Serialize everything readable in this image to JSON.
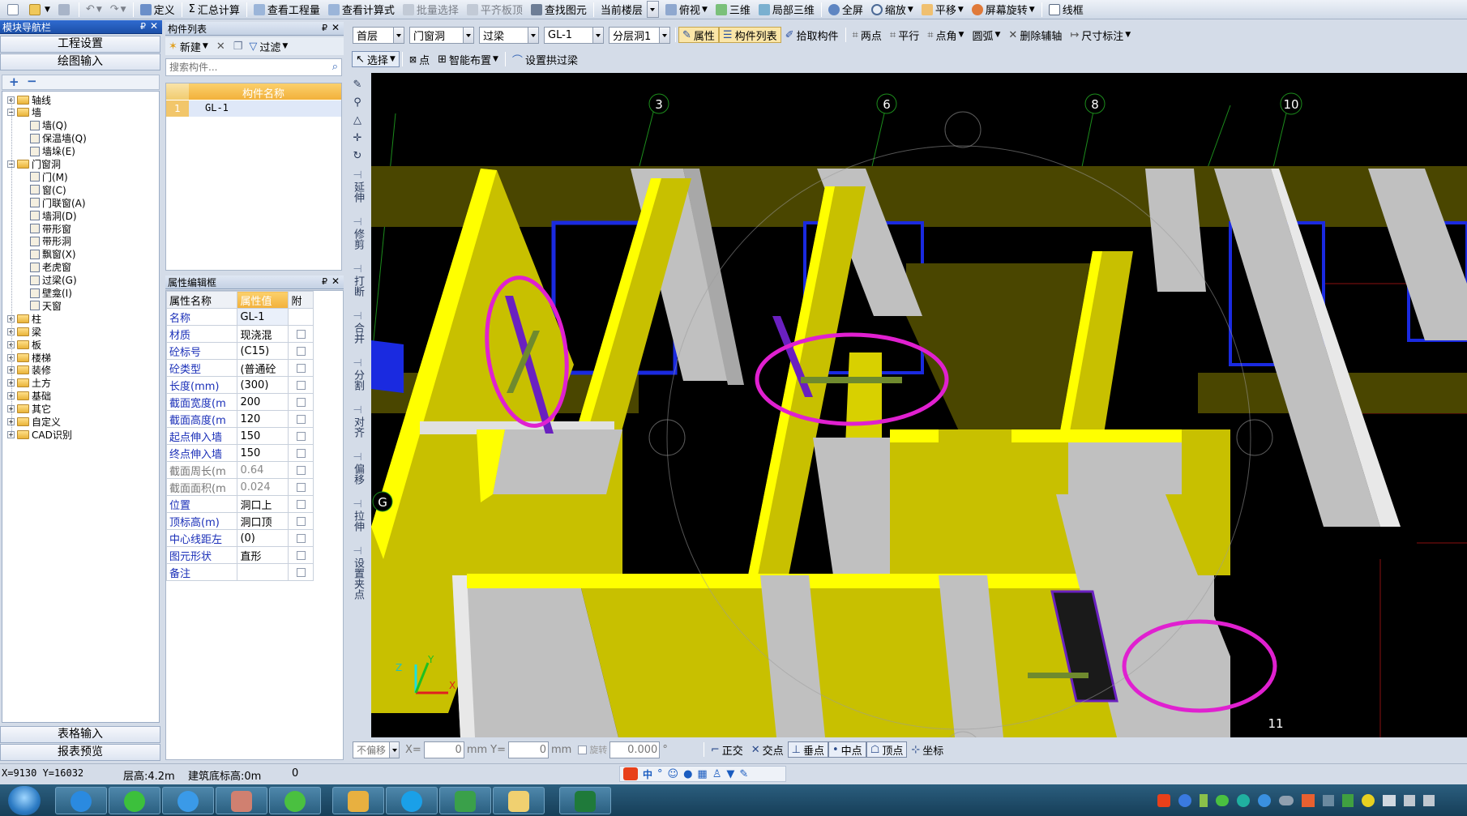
{
  "menu_toolbar": {
    "items": [
      "定义",
      "汇总计算",
      "查看工程量",
      "查看计算式",
      "批量选择",
      "平齐板顶",
      "查找图元",
      "当前楼层",
      "俯视",
      "三维",
      "局部三维",
      "全屏",
      "缩放",
      "平移",
      "屏幕旋转",
      "线框"
    ],
    "disabled": [
      "批量选择",
      "平齐板顶"
    ]
  },
  "nav": {
    "title": "模块导航栏",
    "project_settings": "工程设置",
    "drawing_input": "绘图输入",
    "plus": "+",
    "minus": "−",
    "tree": [
      {
        "label": "轴线",
        "level": 0
      },
      {
        "label": "墙",
        "level": 0,
        "open": true
      },
      {
        "label": "墙(Q)",
        "level": 1
      },
      {
        "label": "保温墙(Q)",
        "level": 1
      },
      {
        "label": "墙垛(E)",
        "level": 1
      },
      {
        "label": "门窗洞",
        "level": 0,
        "open": true
      },
      {
        "label": "门(M)",
        "level": 1
      },
      {
        "label": "窗(C)",
        "level": 1
      },
      {
        "label": "门联窗(A)",
        "level": 1
      },
      {
        "label": "墙洞(D)",
        "level": 1
      },
      {
        "label": "带形窗",
        "level": 1
      },
      {
        "label": "带形洞",
        "level": 1
      },
      {
        "label": "飘窗(X)",
        "level": 1
      },
      {
        "label": "老虎窗",
        "level": 1
      },
      {
        "label": "过梁(G)",
        "level": 1
      },
      {
        "label": "壁龛(I)",
        "level": 1
      },
      {
        "label": "天窗",
        "level": 1
      },
      {
        "label": "柱",
        "level": 0
      },
      {
        "label": "梁",
        "level": 0
      },
      {
        "label": "板",
        "level": 0
      },
      {
        "label": "楼梯",
        "level": 0
      },
      {
        "label": "装修",
        "level": 0
      },
      {
        "label": "土方",
        "level": 0
      },
      {
        "label": "基础",
        "level": 0
      },
      {
        "label": "其它",
        "level": 0
      },
      {
        "label": "自定义",
        "level": 0
      },
      {
        "label": "CAD识别",
        "level": 0
      }
    ],
    "table_input": "表格输入",
    "report_preview": "报表预览"
  },
  "component_list": {
    "title": "构件列表",
    "new_btn": "新建",
    "filter_btn": "过滤",
    "search_placeholder": "搜索构件...",
    "col_header": "构件名称",
    "rows": [
      {
        "num": "1",
        "name": "GL-1"
      }
    ]
  },
  "property_editor": {
    "title": "属性编辑框",
    "headers": [
      "属性名称",
      "属性值",
      "附"
    ],
    "rows": [
      {
        "name": "名称",
        "value": "GL-1",
        "grey": false
      },
      {
        "name": "材质",
        "value": "现浇混",
        "grey": false
      },
      {
        "name": "砼标号",
        "value": "(C15)",
        "grey": false
      },
      {
        "name": "砼类型",
        "value": "(普通砼",
        "grey": false
      },
      {
        "name": "长度(mm)",
        "value": "(300)",
        "grey": false
      },
      {
        "name": "截面宽度(m",
        "value": "200",
        "grey": false
      },
      {
        "name": "截面高度(m",
        "value": "120",
        "grey": false
      },
      {
        "name": "起点伸入墙",
        "value": "150",
        "grey": false
      },
      {
        "name": "终点伸入墙",
        "value": "150",
        "grey": false
      },
      {
        "name": "截面周长(m",
        "value": "0.64",
        "grey": true
      },
      {
        "name": "截面面积(m",
        "value": "0.024",
        "grey": true
      },
      {
        "name": "位置",
        "value": "洞口上",
        "grey": false
      },
      {
        "name": "顶标高(m)",
        "value": "洞口顶",
        "grey": false
      },
      {
        "name": "中心线距左",
        "value": "(0)",
        "grey": false
      },
      {
        "name": "图元形状",
        "value": "直形",
        "grey": false
      },
      {
        "name": "备注",
        "value": "",
        "grey": false
      }
    ]
  },
  "toolbar2": {
    "floor": "首层",
    "category": "门窗洞",
    "type": "过梁",
    "component": "GL-1",
    "layer": "分层洞1",
    "attr_btn": "属性",
    "comp_list_btn": "构件列表",
    "pick_btn": "拾取构件",
    "two_points": "两点",
    "parallel": "平行",
    "point_angle": "点角",
    "arc": "圆弧",
    "del_aux": "删除辅轴",
    "dim": "尺寸标注"
  },
  "toolbar3": {
    "select": "选择",
    "point": "点",
    "smart_layout": "智能布置",
    "set_arch_beam": "设置拱过梁"
  },
  "side_tools": [
    "延伸",
    "修剪",
    "打断",
    "合并",
    "分割",
    "对齐",
    "偏移",
    "拉伸",
    "设置夹点"
  ],
  "viewport": {
    "axis_labels": [
      {
        "text": "3"
      },
      {
        "text": "6"
      },
      {
        "text": "8"
      },
      {
        "text": "10"
      },
      {
        "text": "G"
      },
      {
        "text": "11"
      }
    ],
    "triad_labels": [
      "Z",
      "Y",
      "X"
    ]
  },
  "bottom_toolbar": {
    "offset_mode": "不偏移",
    "x_label": "X=",
    "x_value": "0",
    "mm1": "mm",
    "y_label": "Y=",
    "y_value": "0",
    "mm2": "mm",
    "rotate_label": "旋转",
    "rotate_value": "0.000",
    "degree": "°",
    "snaps": [
      "正交",
      "交点",
      "垂点",
      "中点",
      "顶点",
      "坐标"
    ],
    "snaps_on": [
      "垂点",
      "中点",
      "顶点"
    ]
  },
  "status": {
    "coords": "X=9130 Y=16032",
    "floor_height": "层高:4.2m",
    "base_elev": "建筑底标高:0m",
    "num": "0"
  },
  "colors": {
    "wall_yellow": "#c8c000",
    "wall_bright": "#ffff00",
    "wall_grey": "#c0c0c0",
    "highlight": "#e020d0",
    "beam": "#6f8a2e",
    "blue_edge": "#1a2ae0"
  }
}
